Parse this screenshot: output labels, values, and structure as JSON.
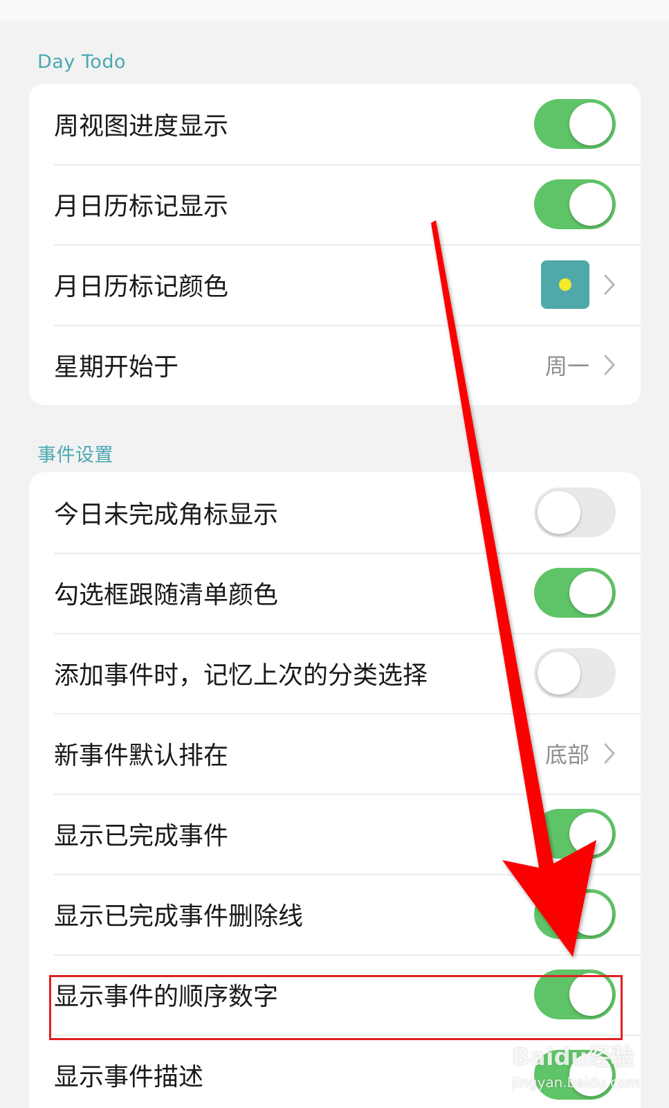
{
  "sections": [
    {
      "title": "Day Todo",
      "rows": [
        {
          "label": "周视图进度显示",
          "type": "toggle",
          "on": true
        },
        {
          "label": "月日历标记显示",
          "type": "toggle",
          "on": true
        },
        {
          "label": "月日历标记颜色",
          "type": "color",
          "swatch_color": "#4fa8aa",
          "dot_color": "#f3ea2a"
        },
        {
          "label": "星期开始于",
          "type": "value",
          "value": "周一"
        }
      ]
    },
    {
      "title": "事件设置",
      "rows": [
        {
          "label": "今日未完成角标显示",
          "type": "toggle",
          "on": false
        },
        {
          "label": "勾选框跟随清单颜色",
          "type": "toggle",
          "on": true
        },
        {
          "label": "添加事件时，记忆上次的分类选择",
          "type": "toggle",
          "on": false
        },
        {
          "label": "新事件默认排在",
          "type": "value",
          "value": "底部"
        },
        {
          "label": "显示已完成事件",
          "type": "toggle",
          "on": true
        },
        {
          "label": "显示已完成事件删除线",
          "type": "toggle",
          "on": true
        },
        {
          "label": "显示事件的顺序数字",
          "type": "toggle",
          "on": true,
          "highlighted": true
        },
        {
          "label": "显示事件描述",
          "type": "toggle",
          "on": true
        }
      ]
    }
  ],
  "watermark": {
    "main": "Baidu经验",
    "sub": "jingyan.baidu.com"
  },
  "colors": {
    "accent": "#4aa8b2",
    "toggle_on": "#5fc467",
    "toggle_off": "#e9e9ea",
    "annotation_red": "#e02020"
  }
}
